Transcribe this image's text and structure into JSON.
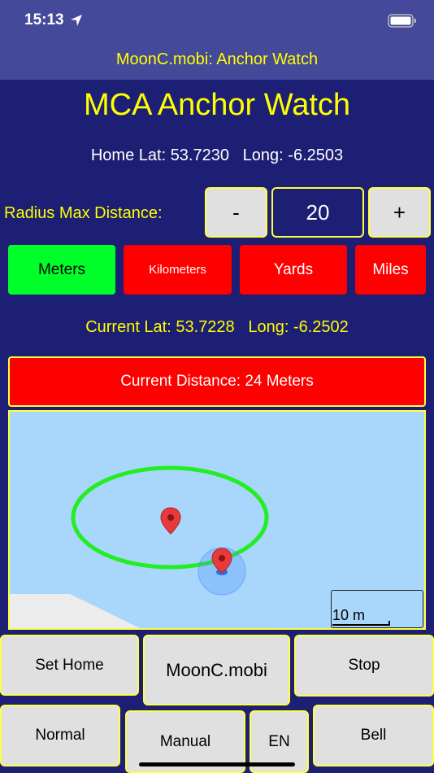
{
  "status": {
    "time": "15:13"
  },
  "nav": {
    "title": "MoonC.mobi: Anchor Watch"
  },
  "app_title": "MCA Anchor Watch",
  "home": {
    "lat_label": "Home Lat:",
    "lat": "53.7230",
    "long_label": "Long:",
    "long": "-6.2503"
  },
  "radius": {
    "label": "Radius Max Distance:",
    "minus": "-",
    "value": "20",
    "plus": "+"
  },
  "units": [
    {
      "label": "Meters",
      "selected": true
    },
    {
      "label": "Kilometers",
      "selected": false
    },
    {
      "label": "Yards",
      "selected": false
    },
    {
      "label": "Miles",
      "selected": false
    }
  ],
  "current": {
    "lat_label": "Current Lat:",
    "lat": "53.7228",
    "long_label": "Long:",
    "long": "-6.2502"
  },
  "distance": {
    "text": "Current Distance: 24 Meters"
  },
  "map": {
    "scale_label": "10 m"
  },
  "buttons": {
    "set_home": "Set Home",
    "moonc": "MoonC.mobi",
    "stop": "Stop",
    "normal": "Normal",
    "manual": "Manual",
    "lang": "EN",
    "bell": "Bell"
  },
  "colors": {
    "background": "#1c1f74",
    "header": "#45499a",
    "accent_yellow": "#ffff00",
    "alert_red": "#ff0000",
    "selected_green": "#00ff2a",
    "button_gray": "#e0e0e0",
    "radius_circle": "#22ee22",
    "water": "#a8d7fb"
  }
}
